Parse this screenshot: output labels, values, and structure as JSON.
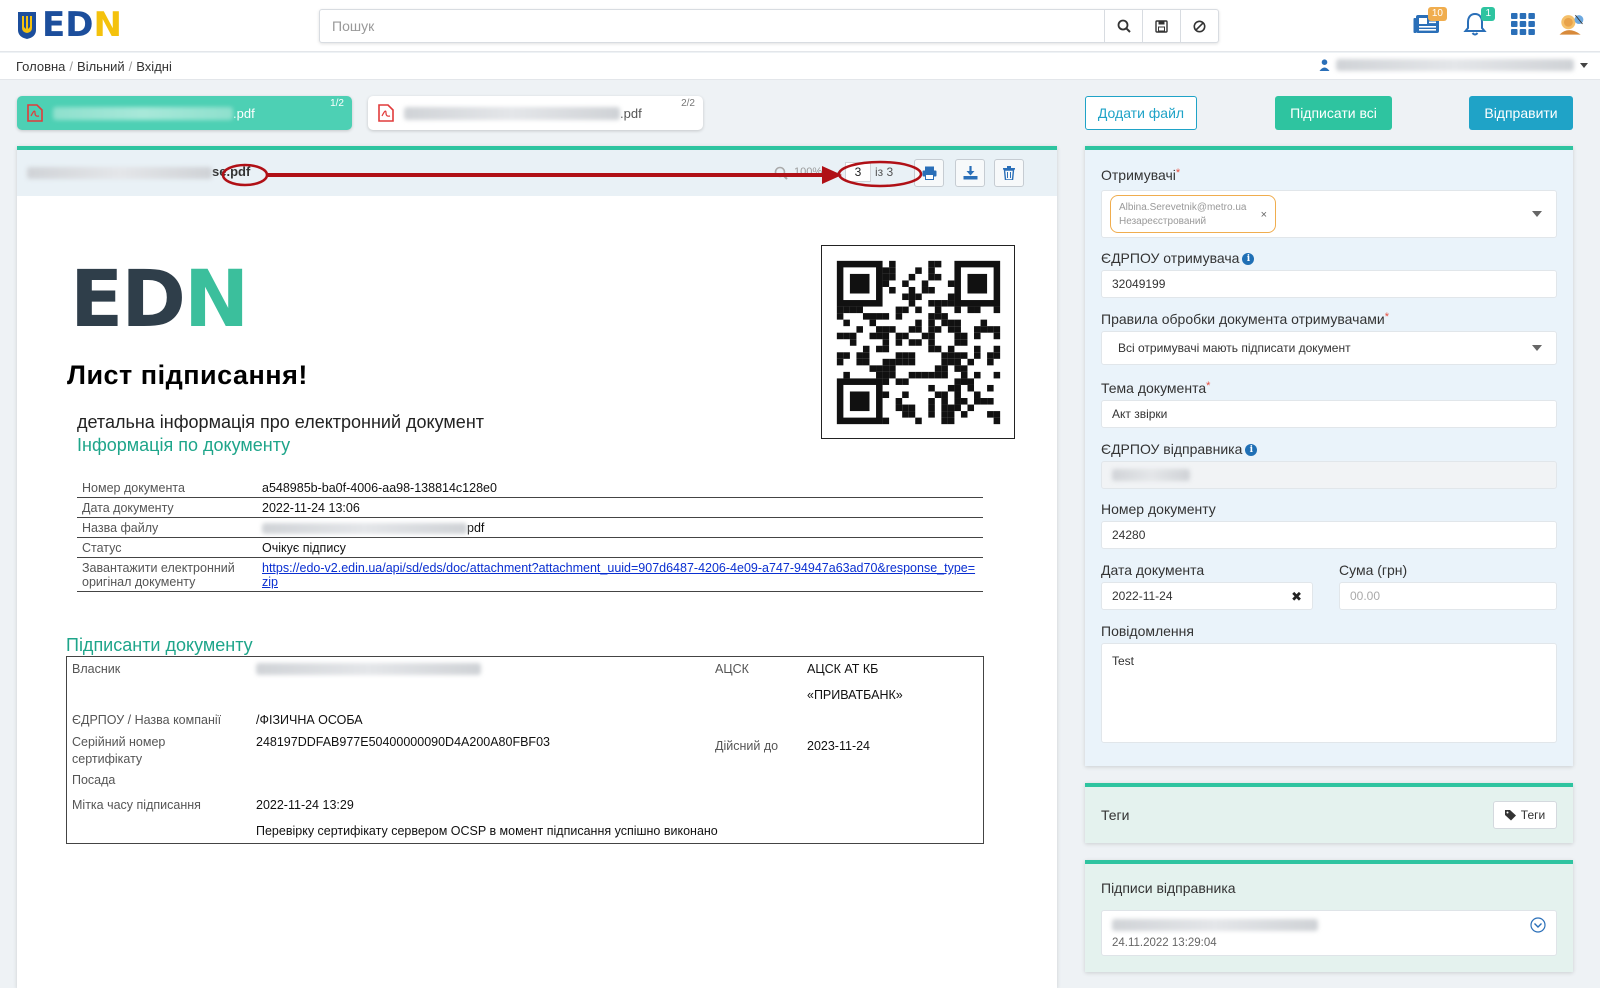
{
  "header": {
    "search_placeholder": "Пошук",
    "badges": {
      "news": "10",
      "notifications": "1"
    }
  },
  "breadcrumb": {
    "items": [
      "Головна",
      "Вільний",
      "Вхідні"
    ]
  },
  "files": [
    {
      "name_suffix": ".pdf",
      "counter": "1/2",
      "active": true
    },
    {
      "name_suffix": ".pdf",
      "counter": "2/2",
      "active": false
    }
  ],
  "actions": {
    "add_file": "Додати файл",
    "sign_all": "Підписати всі",
    "send": "Відправити"
  },
  "viewer": {
    "filename_suffix": "se.pdf",
    "zoom": "100%",
    "page": "3",
    "page_total": "із 3"
  },
  "document": {
    "title": "Лист підписання!",
    "subtitle": "детальна інформація про електронний документ",
    "section_info": "Інформація по документу",
    "info_rows": [
      {
        "key": "Номер документа",
        "value": "a548985b-ba0f-4006-aa98-138814c128e0"
      },
      {
        "key": "Дата документу",
        "value": "2022-11-24 13:06"
      },
      {
        "key": "Назва файлу",
        "value": "pdf"
      },
      {
        "key": "Статус",
        "value": "Очікує підпису"
      },
      {
        "key": "Завантажити електронний оригінал документу",
        "value": "https://edo-v2.edin.ua/api/sd/eds/doc/attachment?attachment_uuid=907d6487-4206-4e09-a747-94947a63ad70&response_type=zip"
      }
    ],
    "section_signers": "Підписанти документу",
    "signer": {
      "owner_label": "Власник",
      "acsk_label": "АЦСК",
      "acsk_value_1": "АЦСК АТ КБ",
      "acsk_value_2": "«ПРИВАТБАНК»",
      "company_label": "ЄДРПОУ / Назва компанії",
      "company_value": "/ФІЗИЧНА ОСОБА",
      "serial_label_1": "Серійний номер",
      "serial_label_2": "сертифікату",
      "serial_value": "248197DDFAB977E50400000090D4A200A80FBF03",
      "valid_label": "Дійсний до",
      "valid_value": "2023-11-24",
      "position_label": "Посада",
      "timestamp_label": "Мітка часу підписання",
      "timestamp_value": "2022-11-24 13:29",
      "ocsp_note": "Перевірку сертифікату сервером OCSP в момент підписання успішно виконано"
    }
  },
  "form": {
    "recipients_label": "Отримувачі",
    "recipient_chip_email": "Albina.Serevetnik@metro.ua",
    "recipient_chip_status": "Незареєстрований",
    "recipient_edrpou_label": "ЄДРПОУ отримувача",
    "recipient_edrpou_value": "32049199",
    "rules_label": "Правила обробки документа отримувачами",
    "rules_value": "Всі отримувачі мають підписати документ",
    "subject_label": "Тема документа",
    "subject_value": "Акт звірки",
    "sender_edrpou_label": "ЄДРПОУ відправника",
    "doc_number_label": "Номер документу",
    "doc_number_value": "24280",
    "doc_date_label": "Дата документа",
    "doc_date_value": "2022-11-24",
    "sum_label": "Сума (грн)",
    "sum_placeholder": "00.00",
    "message_label": "Повідомлення",
    "message_value": "Test"
  },
  "tags": {
    "title": "Теги",
    "button": "Теги"
  },
  "sender_signatures": {
    "title": "Підписи відправника",
    "date": "24.11.2022 13:29:04"
  },
  "colors": {
    "accent_green": "#2ec4a0",
    "accent_blue": "#1fa3c7",
    "annotation_red": "#b01016"
  }
}
